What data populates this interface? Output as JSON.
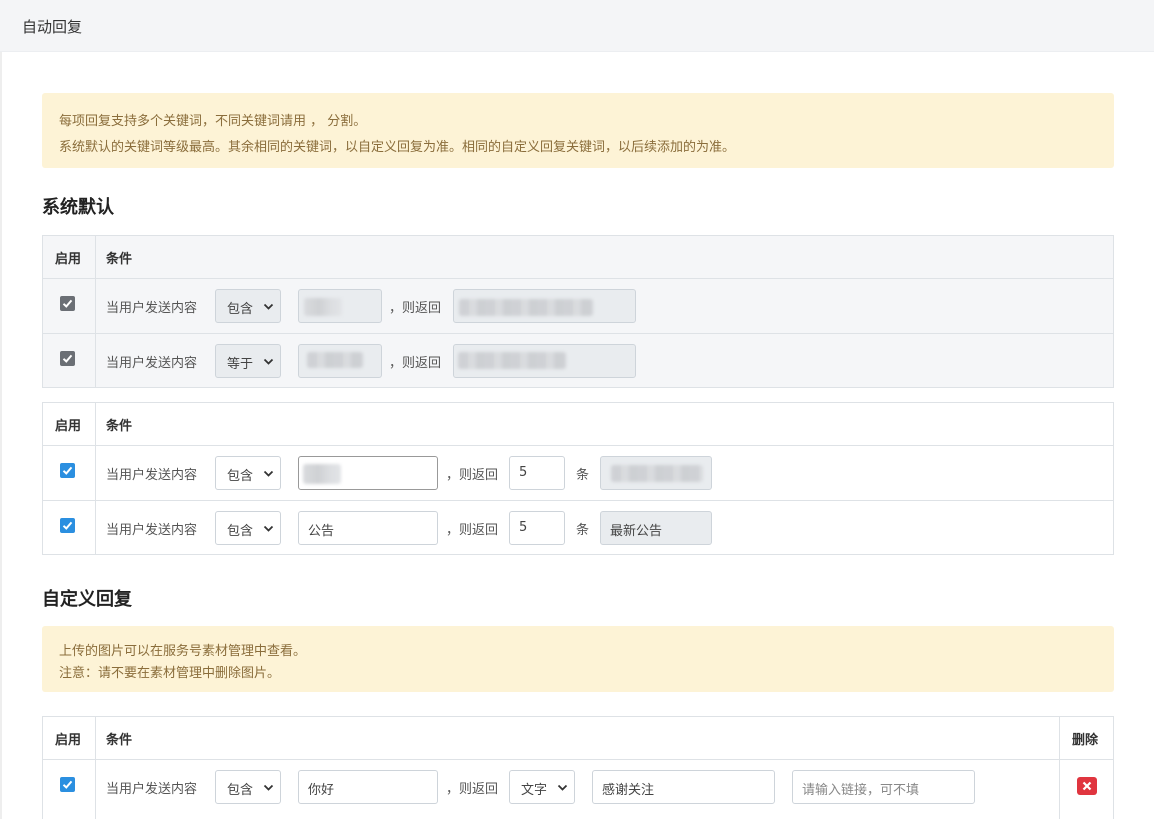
{
  "page": {
    "title": "自动回复"
  },
  "notice1": {
    "line1": "每项回复支持多个关键词，不同关键词请用 ， 分割。",
    "line2": "系统默认的关键词等级最高。其余相同的关键词，以自定义回复为准。相同的自定义回复关键词，以后续添加的为准。"
  },
  "system_section": {
    "title": "系统默认"
  },
  "table_headers": {
    "enable": "启用",
    "condition": "条件",
    "delete": "删除"
  },
  "common": {
    "when_user_sends": "当用户发送内容",
    "then_return": "，则返回",
    "items_unit": "条"
  },
  "system_rows": [
    {
      "enabled": true,
      "match": "包含"
    },
    {
      "enabled": true,
      "match": "等于"
    }
  ],
  "dynamic_rows": [
    {
      "enabled": true,
      "match": "包含",
      "keyword": "",
      "count": "5",
      "result": ""
    },
    {
      "enabled": true,
      "match": "包含",
      "keyword": "公告",
      "count": "5",
      "result": "最新公告"
    }
  ],
  "custom_section": {
    "title": "自定义回复"
  },
  "notice2": {
    "line1": "上传的图片可以在服务号素材管理中查看。",
    "line2": "注意：请不要在素材管理中删除图片。"
  },
  "custom_rows": [
    {
      "enabled": true,
      "match": "包含",
      "keyword": "你好",
      "type": "文字",
      "content": "感谢关注",
      "link_placeholder": "请输入链接，可不填"
    }
  ],
  "colors": {
    "checkbox_blue": "#2b8fe0",
    "checkbox_gray": "#6b6f75",
    "notice_bg": "#fdf3d6",
    "notice_text": "#8a6d3b",
    "delete_red": "#e0353f"
  },
  "icons": {
    "check": "check-icon",
    "dropdown": "chevron-down-icon",
    "delete": "close-icon"
  }
}
